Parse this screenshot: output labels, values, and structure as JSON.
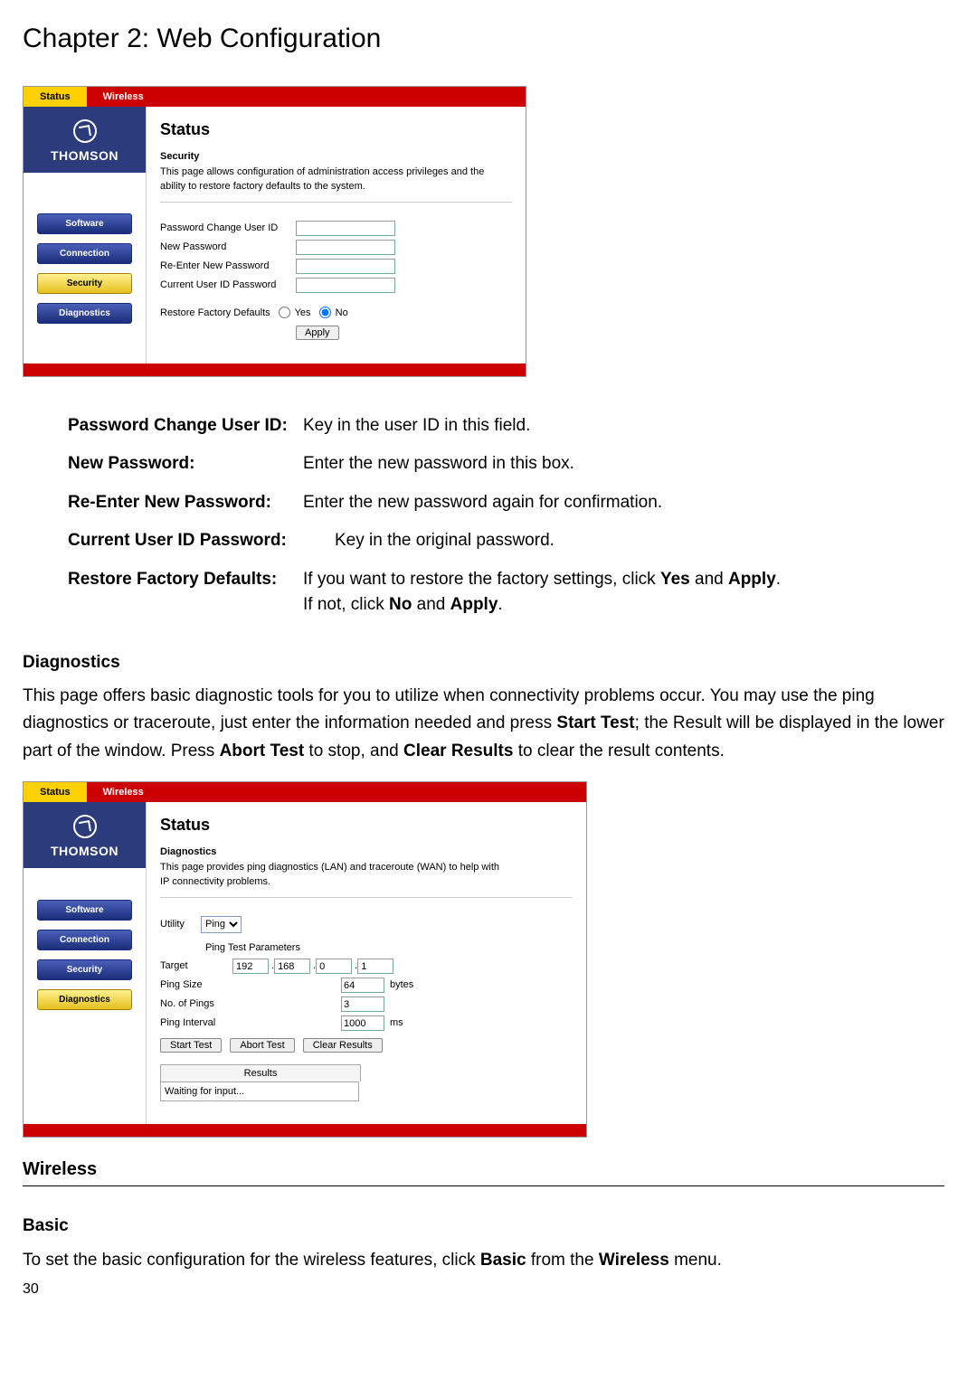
{
  "chapter_title": "Chapter 2: Web Configuration",
  "page_number": "30",
  "tabs": {
    "status": "Status",
    "wireless": "Wireless"
  },
  "brand": "THOMSON",
  "sidebar": {
    "software": "Software",
    "connection": "Connection",
    "security": "Security",
    "diagnostics": "Diagnostics"
  },
  "sec_shot": {
    "h1": "Status",
    "sub": "Security",
    "desc": "This page allows configuration of administration access privileges and the ability to restore factory defaults to the system.",
    "f_userid": "Password Change User ID",
    "f_newpw": "New Password",
    "f_repw": "Re-Enter New Password",
    "f_curpw": "Current User ID Password",
    "f_restore": "Restore Factory Defaults",
    "yes": "Yes",
    "no": "No",
    "apply": "Apply"
  },
  "defs": {
    "r1_term": "Password Change User ID:",
    "r1_desc": "Key in the user ID in this field.",
    "r2_term": "New Password:",
    "r2_desc": "Enter the new password in this box.",
    "r3_term": "Re-Enter New Password:",
    "r3_desc": "Enter the new password again for confirmation.",
    "r4_term": "Current User ID Password:",
    "r4_desc": "Key in the original password.",
    "r5_term": "Restore Factory Defaults:",
    "r5_desc_a": "If you want to restore the factory settings, click ",
    "r5_desc_b": "Yes",
    "r5_desc_c": " and ",
    "r5_desc_d": "Apply",
    "r5_desc_e": ".",
    "r5_desc_f": "If not, click ",
    "r5_desc_g": "No",
    "r5_desc_h": " and ",
    "r5_desc_i": "Apply",
    "r5_desc_j": "."
  },
  "diag_heading": "Diagnostics",
  "diag_para_a": "This page offers basic diagnostic tools for you to utilize when connectivity problems occur. You may use the ping diagnostics or traceroute, just enter the information needed and press ",
  "diag_para_b": "Start Test",
  "diag_para_c": "; the Result will be displayed in the lower part of the window. Press ",
  "diag_para_d": "Abort Test",
  "diag_para_e": " to stop, and ",
  "diag_para_f": "Clear Results",
  "diag_para_g": " to clear the result contents.",
  "diag_shot": {
    "h1": "Status",
    "sub": "Diagnostics",
    "desc": "This page provides ping diagnostics (LAN) and traceroute (WAN) to help with IP connectivity problems.",
    "utility": "Utility",
    "utility_val": "Ping",
    "section": "Ping Test Parameters",
    "target": "Target",
    "ip1": "192",
    "ip2": "168",
    "ip3": "0",
    "ip4": "1",
    "pingsize": "Ping Size",
    "pingsize_val": "64",
    "bytes": "bytes",
    "nopings": "No. of Pings",
    "nopings_val": "3",
    "interval": "Ping Interval",
    "interval_val": "1000",
    "ms": "ms",
    "start": "Start Test",
    "abort": "Abort Test",
    "clear": "Clear Results",
    "results": "Results",
    "waiting": "Waiting for input..."
  },
  "wireless_hdr": "Wireless",
  "basic_hdr": "Basic",
  "basic_para_a": "To set the basic configuration for the wireless features, click ",
  "basic_para_b": "Basic",
  "basic_para_c": " from the ",
  "basic_para_d": "Wireless",
  "basic_para_e": " menu."
}
